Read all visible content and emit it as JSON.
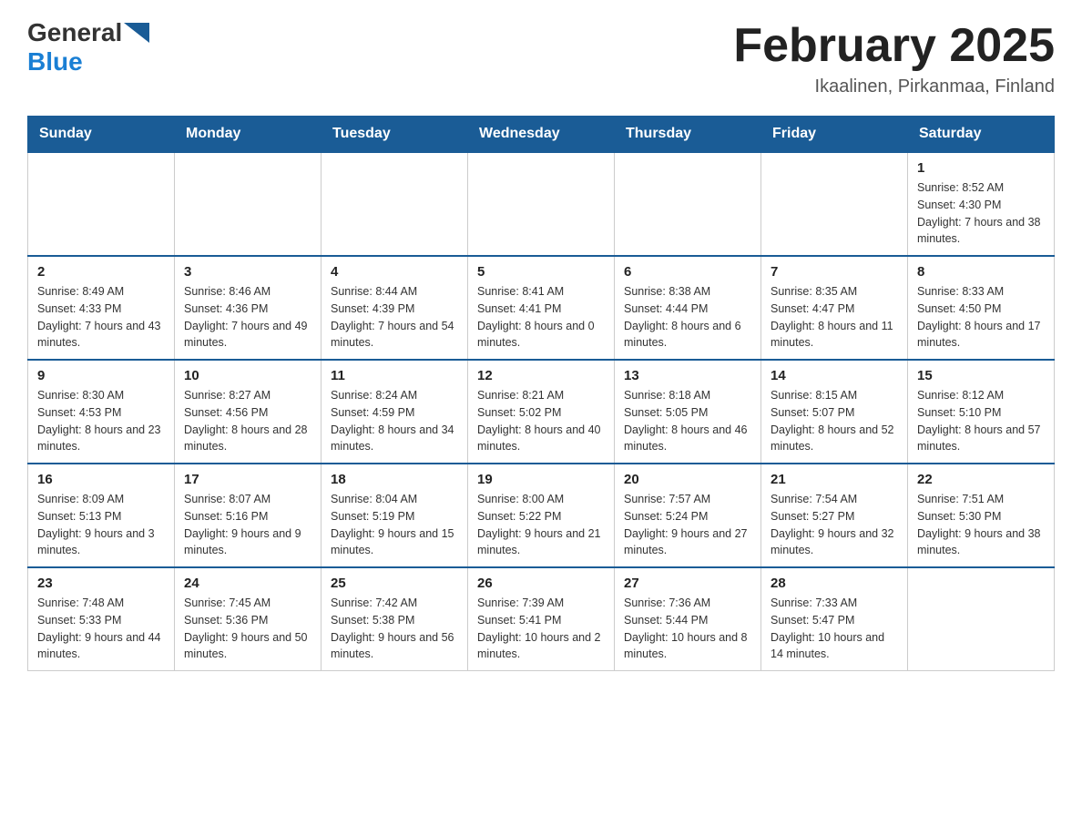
{
  "header": {
    "logo_general": "General",
    "logo_blue": "Blue",
    "month_title": "February 2025",
    "location": "Ikaalinen, Pirkanmaa, Finland"
  },
  "days_of_week": [
    "Sunday",
    "Monday",
    "Tuesday",
    "Wednesday",
    "Thursday",
    "Friday",
    "Saturday"
  ],
  "weeks": [
    [
      null,
      null,
      null,
      null,
      null,
      null,
      {
        "day": "1",
        "sunrise": "Sunrise: 8:52 AM",
        "sunset": "Sunset: 4:30 PM",
        "daylight": "Daylight: 7 hours and 38 minutes."
      }
    ],
    [
      {
        "day": "2",
        "sunrise": "Sunrise: 8:49 AM",
        "sunset": "Sunset: 4:33 PM",
        "daylight": "Daylight: 7 hours and 43 minutes."
      },
      {
        "day": "3",
        "sunrise": "Sunrise: 8:46 AM",
        "sunset": "Sunset: 4:36 PM",
        "daylight": "Daylight: 7 hours and 49 minutes."
      },
      {
        "day": "4",
        "sunrise": "Sunrise: 8:44 AM",
        "sunset": "Sunset: 4:39 PM",
        "daylight": "Daylight: 7 hours and 54 minutes."
      },
      {
        "day": "5",
        "sunrise": "Sunrise: 8:41 AM",
        "sunset": "Sunset: 4:41 PM",
        "daylight": "Daylight: 8 hours and 0 minutes."
      },
      {
        "day": "6",
        "sunrise": "Sunrise: 8:38 AM",
        "sunset": "Sunset: 4:44 PM",
        "daylight": "Daylight: 8 hours and 6 minutes."
      },
      {
        "day": "7",
        "sunrise": "Sunrise: 8:35 AM",
        "sunset": "Sunset: 4:47 PM",
        "daylight": "Daylight: 8 hours and 11 minutes."
      },
      {
        "day": "8",
        "sunrise": "Sunrise: 8:33 AM",
        "sunset": "Sunset: 4:50 PM",
        "daylight": "Daylight: 8 hours and 17 minutes."
      }
    ],
    [
      {
        "day": "9",
        "sunrise": "Sunrise: 8:30 AM",
        "sunset": "Sunset: 4:53 PM",
        "daylight": "Daylight: 8 hours and 23 minutes."
      },
      {
        "day": "10",
        "sunrise": "Sunrise: 8:27 AM",
        "sunset": "Sunset: 4:56 PM",
        "daylight": "Daylight: 8 hours and 28 minutes."
      },
      {
        "day": "11",
        "sunrise": "Sunrise: 8:24 AM",
        "sunset": "Sunset: 4:59 PM",
        "daylight": "Daylight: 8 hours and 34 minutes."
      },
      {
        "day": "12",
        "sunrise": "Sunrise: 8:21 AM",
        "sunset": "Sunset: 5:02 PM",
        "daylight": "Daylight: 8 hours and 40 minutes."
      },
      {
        "day": "13",
        "sunrise": "Sunrise: 8:18 AM",
        "sunset": "Sunset: 5:05 PM",
        "daylight": "Daylight: 8 hours and 46 minutes."
      },
      {
        "day": "14",
        "sunrise": "Sunrise: 8:15 AM",
        "sunset": "Sunset: 5:07 PM",
        "daylight": "Daylight: 8 hours and 52 minutes."
      },
      {
        "day": "15",
        "sunrise": "Sunrise: 8:12 AM",
        "sunset": "Sunset: 5:10 PM",
        "daylight": "Daylight: 8 hours and 57 minutes."
      }
    ],
    [
      {
        "day": "16",
        "sunrise": "Sunrise: 8:09 AM",
        "sunset": "Sunset: 5:13 PM",
        "daylight": "Daylight: 9 hours and 3 minutes."
      },
      {
        "day": "17",
        "sunrise": "Sunrise: 8:07 AM",
        "sunset": "Sunset: 5:16 PM",
        "daylight": "Daylight: 9 hours and 9 minutes."
      },
      {
        "day": "18",
        "sunrise": "Sunrise: 8:04 AM",
        "sunset": "Sunset: 5:19 PM",
        "daylight": "Daylight: 9 hours and 15 minutes."
      },
      {
        "day": "19",
        "sunrise": "Sunrise: 8:00 AM",
        "sunset": "Sunset: 5:22 PM",
        "daylight": "Daylight: 9 hours and 21 minutes."
      },
      {
        "day": "20",
        "sunrise": "Sunrise: 7:57 AM",
        "sunset": "Sunset: 5:24 PM",
        "daylight": "Daylight: 9 hours and 27 minutes."
      },
      {
        "day": "21",
        "sunrise": "Sunrise: 7:54 AM",
        "sunset": "Sunset: 5:27 PM",
        "daylight": "Daylight: 9 hours and 32 minutes."
      },
      {
        "day": "22",
        "sunrise": "Sunrise: 7:51 AM",
        "sunset": "Sunset: 5:30 PM",
        "daylight": "Daylight: 9 hours and 38 minutes."
      }
    ],
    [
      {
        "day": "23",
        "sunrise": "Sunrise: 7:48 AM",
        "sunset": "Sunset: 5:33 PM",
        "daylight": "Daylight: 9 hours and 44 minutes."
      },
      {
        "day": "24",
        "sunrise": "Sunrise: 7:45 AM",
        "sunset": "Sunset: 5:36 PM",
        "daylight": "Daylight: 9 hours and 50 minutes."
      },
      {
        "day": "25",
        "sunrise": "Sunrise: 7:42 AM",
        "sunset": "Sunset: 5:38 PM",
        "daylight": "Daylight: 9 hours and 56 minutes."
      },
      {
        "day": "26",
        "sunrise": "Sunrise: 7:39 AM",
        "sunset": "Sunset: 5:41 PM",
        "daylight": "Daylight: 10 hours and 2 minutes."
      },
      {
        "day": "27",
        "sunrise": "Sunrise: 7:36 AM",
        "sunset": "Sunset: 5:44 PM",
        "daylight": "Daylight: 10 hours and 8 minutes."
      },
      {
        "day": "28",
        "sunrise": "Sunrise: 7:33 AM",
        "sunset": "Sunset: 5:47 PM",
        "daylight": "Daylight: 10 hours and 14 minutes."
      },
      null
    ]
  ]
}
